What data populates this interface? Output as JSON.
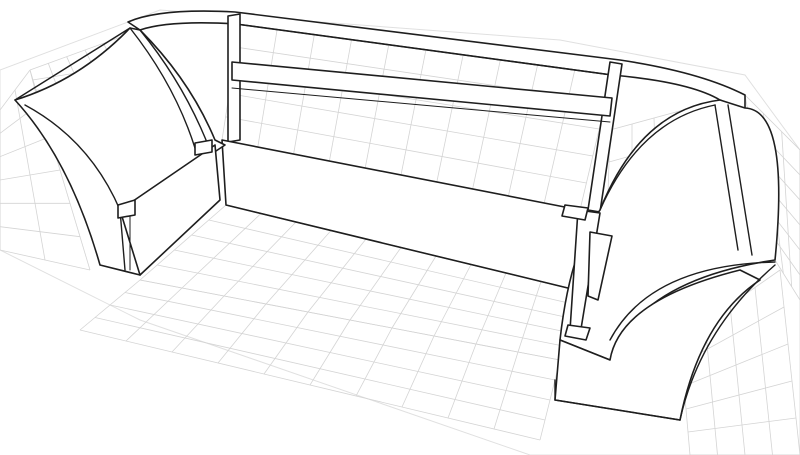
{
  "image": {
    "subject": "sofa-wireframe-sketch",
    "colors": {
      "background": "#ffffff",
      "line": "#1e1e1e",
      "grid": "#d4d4d4"
    }
  }
}
